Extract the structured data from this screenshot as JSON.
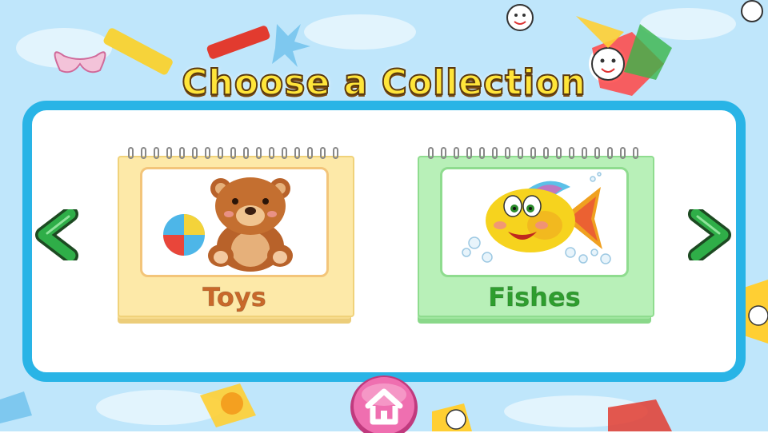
{
  "screen": {
    "title": "Choose a Collection"
  },
  "collections": [
    {
      "label": "Toys",
      "picture": "teddy-bear-with-ball"
    },
    {
      "label": "Fishes",
      "picture": "smiling-yellow-fish"
    }
  ],
  "nav": {
    "prev_icon": "chevron-left-icon",
    "next_icon": "chevron-right-icon",
    "home_icon": "home-icon"
  },
  "colors": {
    "panel_border": "#29b4e6",
    "toys_card": "#fde9a8",
    "fishes_card": "#b8f0b8",
    "arrow_green": "#2fae48",
    "home_pink": "#e85aa0",
    "title_yellow": "#ffe53a"
  }
}
